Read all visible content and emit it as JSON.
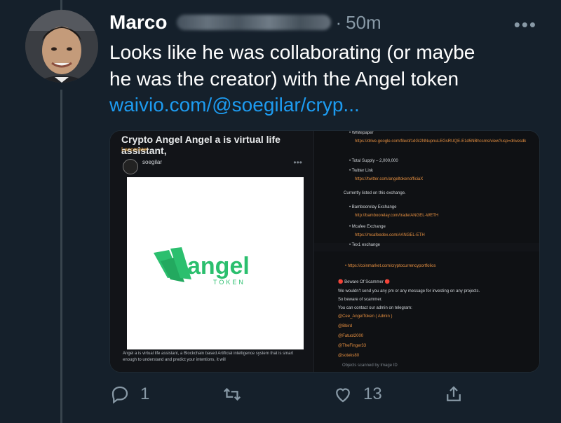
{
  "author": {
    "name": "Marco",
    "separator": "·",
    "time": "50m",
    "more": "•••"
  },
  "tweet": {
    "line1": "Looks like he was collaborating (or maybe",
    "line2": "he was the creator) with the Angel token",
    "link": "waivio.com/@soegilar/cryp..."
  },
  "media": {
    "left": {
      "title": "Crypto Angel Angel a is virtual life assistant,",
      "tag": "Lanometer",
      "post_author": "soegilar",
      "post_dots": "•••",
      "logo_word": "angel",
      "logo_sub": "TOKEN",
      "desc": "Angel a is virtual life assistant, a Blockchain based Artificial intelligence system that is smart enough to understand and predict your intentions, it will"
    },
    "right": {
      "top_lines": [
        "• Whitepaper",
        "https://drive.google.com/file/d/1dGl2NNupnuLEGsRUQE-E1d5NBhcsms/view?usp=drivesdk",
        "• Total Supply – 2,000,000",
        "• Twitter Link",
        "https://twitter.com/angeltokenofficiaX",
        "Currently listed on this exchange.",
        "• Bamboorelay Exchange",
        "http://bamboorelay.com/trade/ANGEL-WETH",
        "• Mcafee Exchange",
        "https://mcafeedex.com/#ANGEL-ETH",
        "• Tex1 exchange"
      ],
      "bottom_lines": [
        "• https://coinmarket.com/cryptocurrencyportfolios",
        "🔴 Beware Of Scammer 🔴",
        "We wouldn't send you any pm or any message for investing on any projects.",
        "So beware of scammer.",
        "You can contact our admin on telegram:",
        "@Cee_AngelToken ( Admin )",
        "@Bbird",
        "@Fatuol2000",
        "@TheFinger33",
        "@soteks80",
        "Objects scanned by Image ID"
      ]
    }
  },
  "actions": {
    "reply_count": "1",
    "retweet_count": "",
    "like_count": "13"
  },
  "colors": {
    "background": "#15202b",
    "link": "#1d9bf0",
    "muted": "#8899a6",
    "brand_green": "#2bbf6e"
  }
}
